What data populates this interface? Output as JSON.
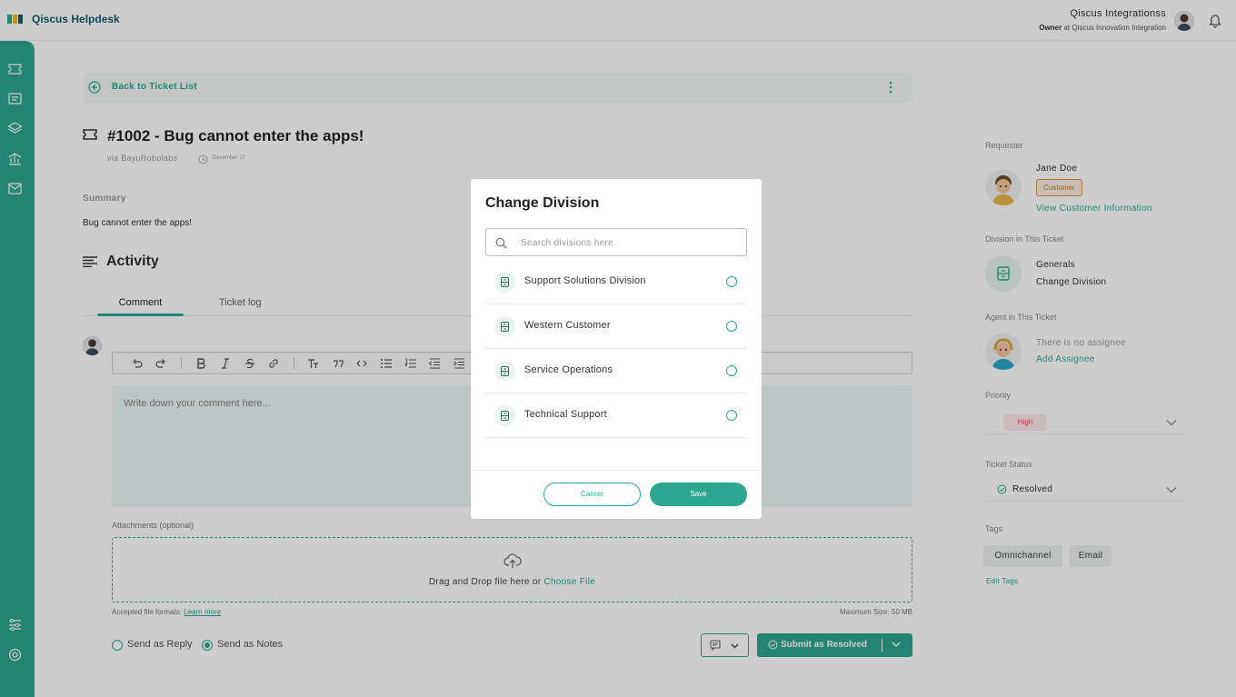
{
  "app": {
    "title": "Qiscus Helpdesk"
  },
  "user": {
    "name": "Qiscus Integrationss",
    "role_prefix": "Owner",
    "role_suffix": "at Qiscus Innovation Integration"
  },
  "colors": {
    "accent": "#2ba88f",
    "priority_high": "#e05565",
    "customer_badge": "#d9944b"
  },
  "sidebar": {
    "icons": [
      "ticket-icon",
      "contacts-icon",
      "layers-icon",
      "analytics-icon",
      "inbox-icon",
      "settings-sliders-icon",
      "help-circle-icon"
    ]
  },
  "ticket": {
    "back_label": "Back to Ticket List",
    "title": "#1002 - Bug cannot enter the apps!",
    "via": "via BayuRobolabs",
    "date": "December 17",
    "summary_label": "Summary",
    "summary": "Bug cannot enter the apps!"
  },
  "activity": {
    "title": "Activity",
    "tabs": [
      {
        "label": "Comment",
        "active": true
      },
      {
        "label": "Ticket log",
        "active": false
      }
    ],
    "editor_placeholder": "Write down your comment here...",
    "attachments_label": "Attachments (optional)",
    "drop_text": "Drag and Drop file here or",
    "choose_file": "Choose File",
    "accepted_prefix": "Accepted file formats:",
    "learn_more": "Learn more",
    "max_size": "Maximum Size: 50 MB",
    "send_reply": "Send as Reply",
    "send_notes": "Send as Notes",
    "selected_send_mode": "Send as Notes",
    "submit_label": "Submit as Resolved"
  },
  "panel": {
    "requester_label": "Requester",
    "requester_name": "Jane Doe",
    "requester_badge": "Customer",
    "view_customer": "View Customer Information",
    "division_label": "Division in This Ticket",
    "division_name": "Generals",
    "change_division": "Change Division",
    "agent_label": "Agent in This Ticket",
    "no_assignee": "There is no assignee",
    "add_assignee": "Add Assignee",
    "priority_label": "Priority",
    "priority_value": "High",
    "status_label": "Ticket Status",
    "status_value": "Resolved",
    "tags_label": "Tags",
    "tags": [
      "Omnichannel",
      "Email"
    ],
    "edit_tags": "Edit Tags"
  },
  "modal": {
    "title": "Change Division",
    "search_placeholder": "Search divisions here",
    "divisions": [
      {
        "name": "Support Solutions Division",
        "selected": false
      },
      {
        "name": "Western Customer",
        "selected": false
      },
      {
        "name": "Service Operations",
        "selected": false
      },
      {
        "name": "Technical Support",
        "selected": false
      }
    ],
    "cancel_label": "Cancel",
    "save_label": "Save"
  }
}
